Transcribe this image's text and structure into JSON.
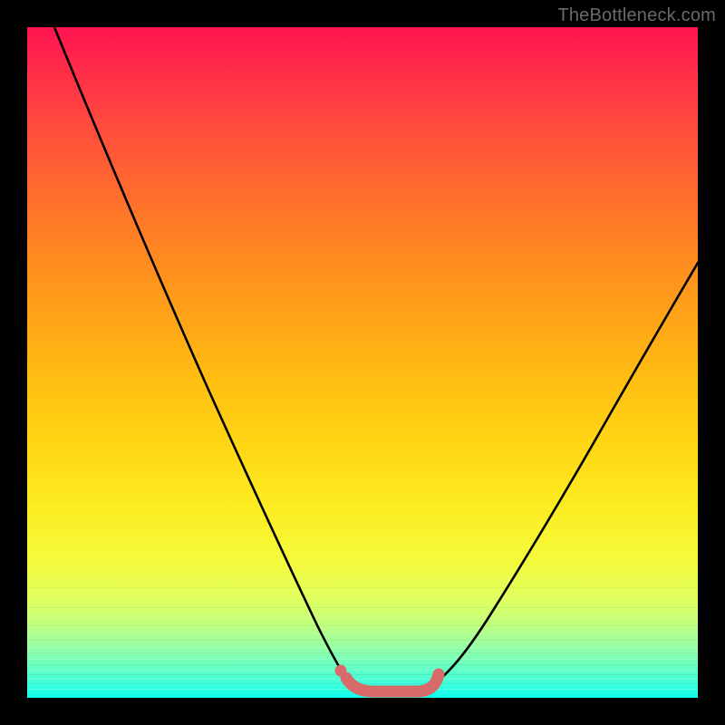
{
  "watermark": "TheBottleneck.com",
  "colors": {
    "frame": "#000000",
    "curve": "#000000",
    "marker": "#d96a6a",
    "band_stroke_mode": "alternating-light-green"
  },
  "chart_data": {
    "type": "line",
    "title": "",
    "xlabel": "",
    "ylabel": "",
    "xlim": [
      0,
      100
    ],
    "ylim": [
      0,
      100
    ],
    "grid": false,
    "series": [
      {
        "name": "left-branch",
        "x": [
          4,
          8,
          12,
          16,
          20,
          24,
          28,
          32,
          36,
          40,
          44,
          46
        ],
        "values": [
          100,
          90,
          80,
          70,
          60,
          50,
          40,
          30,
          20,
          10,
          3,
          1
        ]
      },
      {
        "name": "right-branch",
        "x": [
          60,
          64,
          68,
          72,
          76,
          80,
          84,
          88,
          92,
          96,
          100
        ],
        "values": [
          1,
          4,
          9,
          15,
          22,
          29,
          36,
          43,
          50,
          56,
          62
        ]
      },
      {
        "name": "flat-bottom-highlight",
        "x": [
          46,
          48,
          50,
          52,
          54,
          56,
          58,
          60
        ],
        "values": [
          1,
          0.5,
          0.5,
          0.5,
          0.5,
          0.5,
          0.5,
          1
        ]
      }
    ],
    "annotations": []
  }
}
